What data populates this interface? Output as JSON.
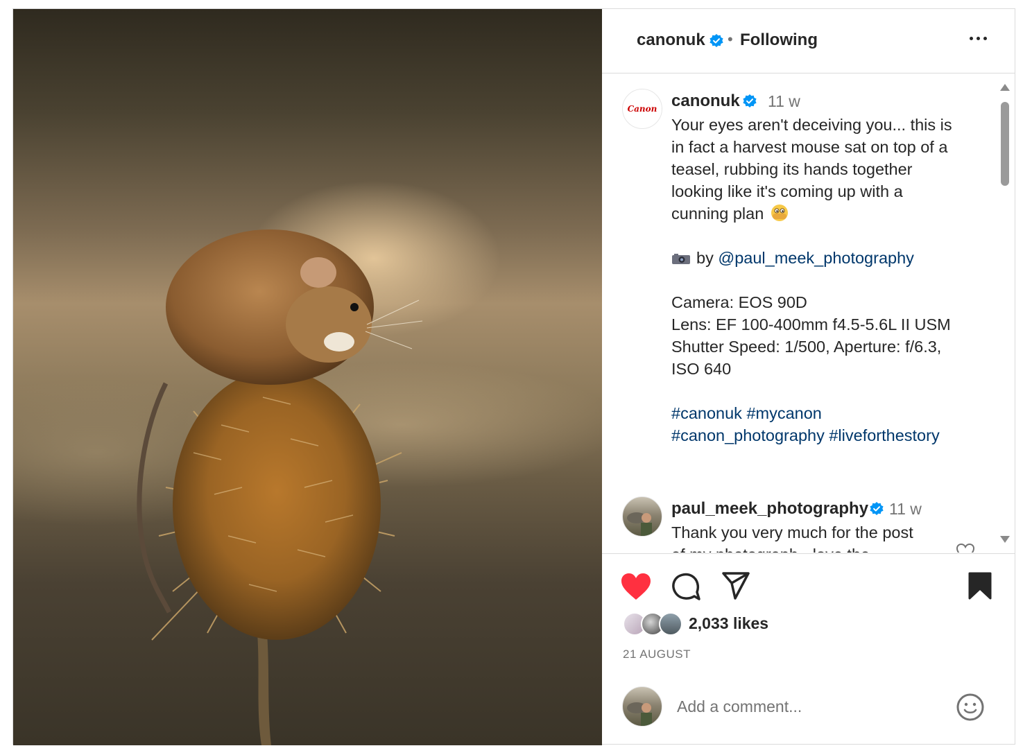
{
  "header": {
    "username": "canonuk",
    "separator": "•",
    "follow_status": "Following"
  },
  "post": {
    "author": "canonuk",
    "avatar_text": "Canon",
    "time": "11 w",
    "caption_lines": [
      "Your eyes aren't deceiving you... this is",
      "in fact a harvest mouse sat on top of a",
      "teasel, rubbing its hands together",
      "looking like it's coming up with a",
      "cunning plan"
    ],
    "credit_prefix": "by",
    "credit_mention": "@paul_meek_photography",
    "specs": [
      "Camera: EOS 90D",
      "Lens: EF 100-400mm f4.5-5.6L II USM",
      "Shutter Speed: 1/500, Aperture: f/6.3,",
      "ISO 640"
    ],
    "hashtags_line1": "#canonuk #mycanon",
    "hashtags_line2": "#canon_photography #liveforthestory"
  },
  "comments": [
    {
      "username": "paul_meek_photography",
      "time": "11 w",
      "text_line1": "Thank you very much for the post",
      "text_line2": "of my photograph - love the"
    }
  ],
  "engagement": {
    "likes": "2,033 likes",
    "date": "21 AUGUST",
    "liked": true,
    "saved": true
  },
  "comment_box": {
    "placeholder": "Add a comment..."
  },
  "colors": {
    "verified": "#0095f6",
    "like_red": "#ff3040",
    "link": "#00376b"
  },
  "icons": [
    "verified-badge-icon",
    "more-options-icon",
    "heart-icon",
    "comment-icon",
    "share-icon",
    "bookmark-icon",
    "emoji-icon",
    "camera-icon",
    "peeking-face-emoji"
  ]
}
